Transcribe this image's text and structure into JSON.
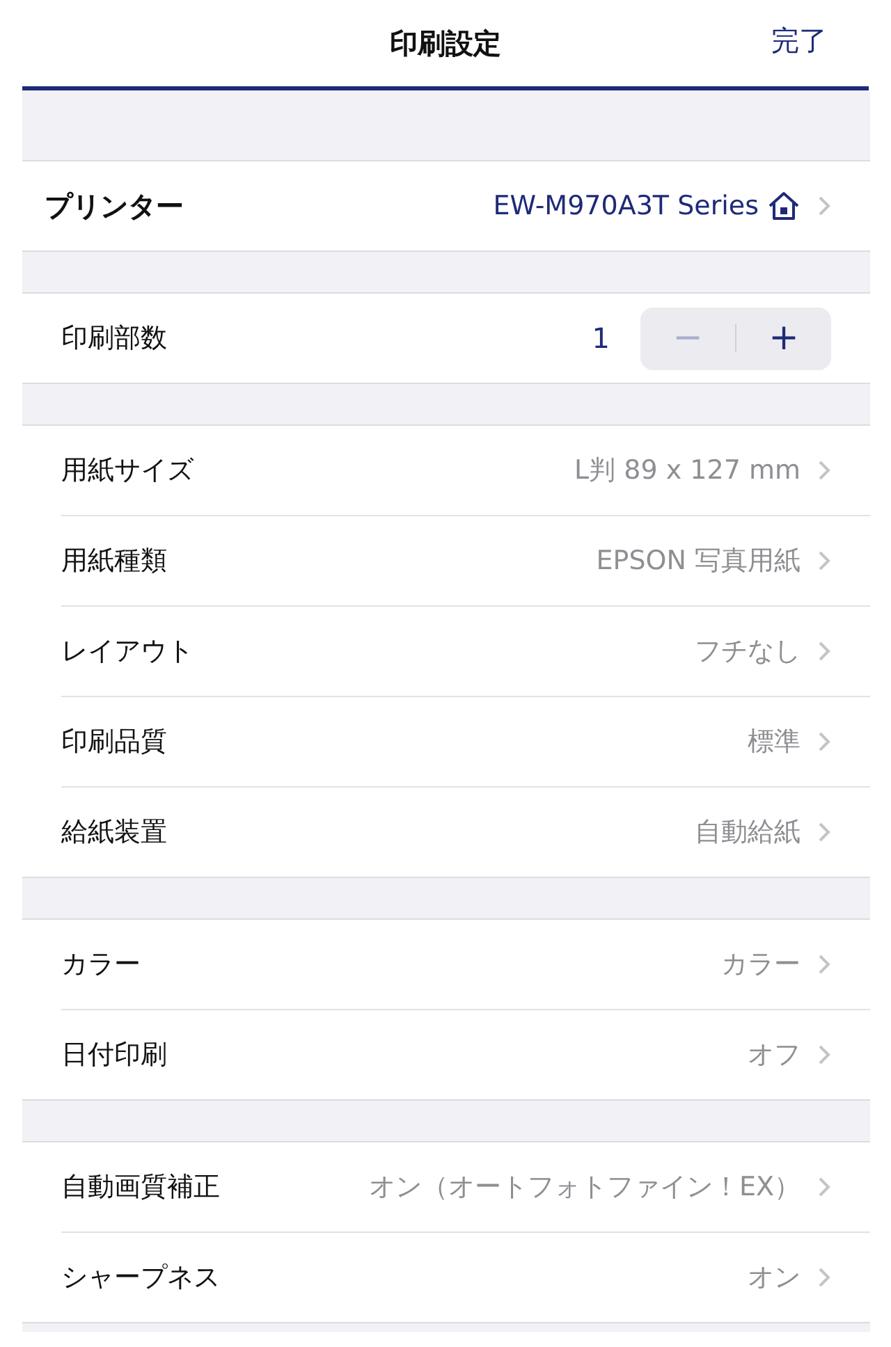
{
  "nav_bar": {
    "title": "印刷設定",
    "done": "完了"
  },
  "sections": [
    {
      "rows": [
        {
          "kind": "device",
          "label": "プリンター",
          "value": "EW-M970A3T Series"
        }
      ]
    },
    {
      "rows": [
        {
          "kind": "stepper",
          "label": "印刷部数",
          "value": "1",
          "minus": {
            "label": "−",
            "disabled": true
          },
          "plus": {
            "label": "+",
            "disabled": false
          }
        }
      ]
    },
    {
      "rows": [
        {
          "kind": "link",
          "label": "用紙サイズ",
          "value": "L判 89 x 127 mm"
        },
        {
          "kind": "link",
          "label": "用紙種類",
          "value": "EPSON 写真用紙"
        },
        {
          "kind": "link",
          "label": "レイアウト",
          "value": "フチなし"
        },
        {
          "kind": "link",
          "label": "印刷品質",
          "value": "標準"
        },
        {
          "kind": "link",
          "label": "給紙装置",
          "value": "自動給紙"
        }
      ]
    },
    {
      "rows": [
        {
          "kind": "link",
          "label": "カラー",
          "value": "カラー"
        },
        {
          "kind": "link",
          "label": "日付印刷",
          "value": "オフ"
        }
      ]
    },
    {
      "rows": [
        {
          "kind": "link",
          "label": "自動画質補正",
          "value": "オン（オートフォトファイン！EX）"
        },
        {
          "kind": "link",
          "label": "シャープネス",
          "value": "オン"
        }
      ]
    }
  ]
}
